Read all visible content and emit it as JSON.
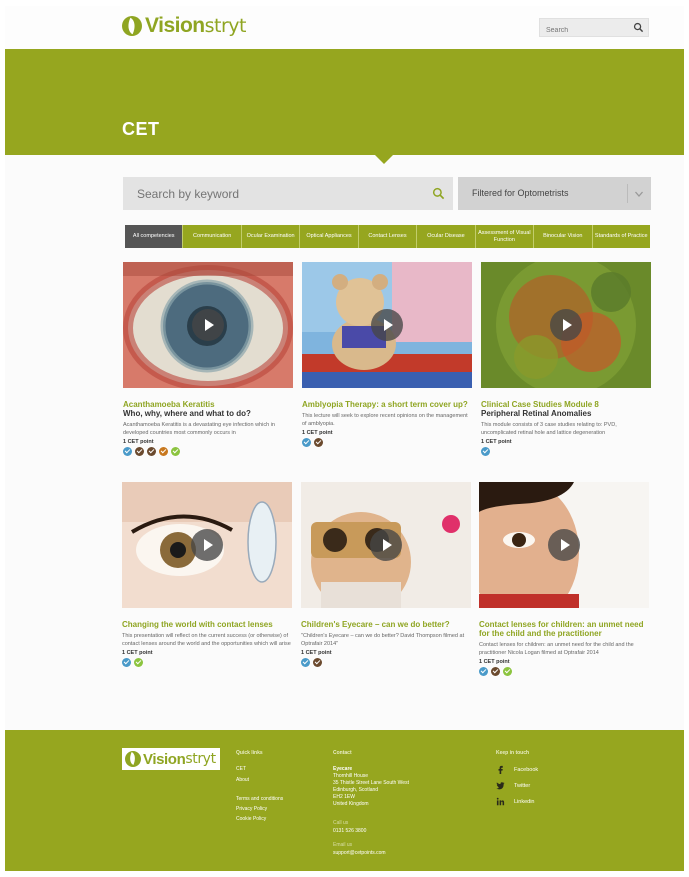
{
  "header": {
    "logo_bold": "Vision",
    "logo_light": "stryt",
    "search_placeholder": "Search"
  },
  "hero": {
    "title": "CET"
  },
  "filters": {
    "keyword_placeholder": "Search by keyword",
    "filter_value": "Filtered for Optometrists"
  },
  "tabs": [
    {
      "label": "All competencies"
    },
    {
      "label": "Communication"
    },
    {
      "label": "Ocular Examination"
    },
    {
      "label": "Optical Appliances"
    },
    {
      "label": "Contact Lenses"
    },
    {
      "label": "Ocular Disease"
    },
    {
      "label": "Assessment of Visual Function"
    },
    {
      "label": "Binocular Vision"
    },
    {
      "label": "Standards of Practice"
    }
  ],
  "colors": {
    "brand_green": "#96a61f",
    "competency_blue": "#4a9ac9",
    "competency_brown": "#6b4a2e",
    "competency_orange": "#c8781e",
    "competency_lightgreen": "#8cc43f"
  },
  "cards": [
    {
      "title": "Acanthamoeba Keratitis",
      "subtitle": "Who, why, where and what to do?",
      "description": "Acanthamoeba Keratitis is a devastating eye infection which in developed countries most commonly occurs in",
      "points": "1 CET point",
      "competencies": [
        "blue",
        "brown",
        "brown",
        "orange",
        "lightgreen"
      ]
    },
    {
      "title": "Amblyopia Therapy: a short term cover up?",
      "subtitle": "",
      "description": "This lecture will seek to explore recent opinions on the management of amblyopia.",
      "points": "1 CET point",
      "competencies": [
        "blue",
        "brown"
      ]
    },
    {
      "title": "Clinical Case Studies Module 8",
      "subtitle": "Peripheral Retinal Anomalies",
      "description": "This module consists of 3 case studies relating to: PVD, uncomplicated retinal hole and lattice degeneration",
      "points": "1 CET point",
      "competencies": [
        "blue"
      ]
    },
    {
      "title": "Changing the world with contact lenses",
      "subtitle": "",
      "description": "This presentation will reflect on the current success (or otherwise) of contact lenses around the world and the opportunities which will arise in the coming years.",
      "points": "1 CET point",
      "competencies": [
        "blue",
        "lightgreen"
      ]
    },
    {
      "title": "Children's Eyecare – can we do better?",
      "subtitle": "",
      "description": "\"Children's Eyecare – can we do better? David Thompson filmed at Optrafair 2014\"",
      "points": "1 CET point",
      "competencies": [
        "blue",
        "brown"
      ]
    },
    {
      "title": "Contact lenses for children: an unmet need for the child and the practitioner",
      "subtitle": "",
      "description": "Contact lenses for children: an unmet need for the child and the practitioner Nicola Logan filmed at Optrafair 2014",
      "points": "1 CET point",
      "competencies": [
        "blue",
        "brown",
        "lightgreen"
      ]
    }
  ],
  "footer": {
    "logo_bold": "Vision",
    "logo_light": "stryt",
    "quick_links_heading": "Quick links",
    "quick_links": [
      "CET",
      "About"
    ],
    "legal_links": [
      "Terms and conditions",
      "Privacy Policy",
      "Cookie Policy"
    ],
    "contact_heading": "Contact",
    "company": "Eyecare",
    "address": [
      "Thornhill House",
      "35 Thistle Street Lane South West",
      "Edinburgh, Scotland",
      "EH2 1EW",
      "United Kingdom"
    ],
    "call_label": "Call us",
    "phone": "0131 526 3800",
    "email_label": "Email us",
    "email": "support@cetpoints.com",
    "keep_in_touch_heading": "Keep in touch",
    "social": [
      "Facebook",
      "Twitter",
      "Linkedin"
    ]
  }
}
